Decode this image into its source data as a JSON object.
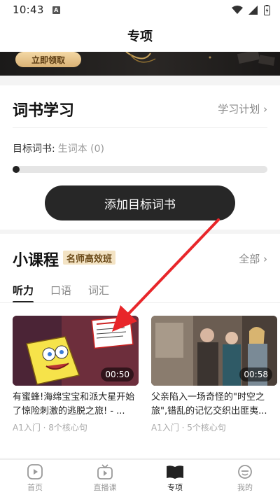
{
  "status": {
    "time": "10:43",
    "a_badge": "A"
  },
  "nav": {
    "title": "专项"
  },
  "banner": {
    "claim_label": "立即领取"
  },
  "book": {
    "title": "词书学习",
    "plan_label": "学习计划",
    "goal_label": "目标词书:",
    "goal_value": "生词本 (0)",
    "progress_fraction": 0.02,
    "add_button": "添加目标词书"
  },
  "course": {
    "title": "小课程",
    "badge": "名师高效班",
    "all_label": "全部",
    "tabs": [
      {
        "label": "听力",
        "active": true
      },
      {
        "label": "口语",
        "active": false
      },
      {
        "label": "词汇",
        "active": false
      }
    ],
    "videos": [
      {
        "duration": "00:50",
        "title": "有蜜蜂!海绵宝宝和派大星开始了惊险刺激的逃脱之旅! - ...",
        "meta": "A1入门 · 8个核心句"
      },
      {
        "duration": "00:58",
        "title": "父亲陷入一场奇怪的\"时空之旅\",错乱的记忆交织出匪夷...",
        "meta": "A1入门 · 5个核心句"
      }
    ]
  },
  "bottom_nav": [
    {
      "label": "首页",
      "icon": "home-play-icon",
      "active": false
    },
    {
      "label": "直播课",
      "icon": "tv-play-icon",
      "active": false
    },
    {
      "label": "专项",
      "icon": "book-icon",
      "active": true
    },
    {
      "label": "我的",
      "icon": "profile-face-icon",
      "active": false
    }
  ],
  "colors": {
    "accent_dark": "#272727",
    "badge_bg": "#f3e3c4",
    "annotation_arrow": "#e8262a"
  }
}
